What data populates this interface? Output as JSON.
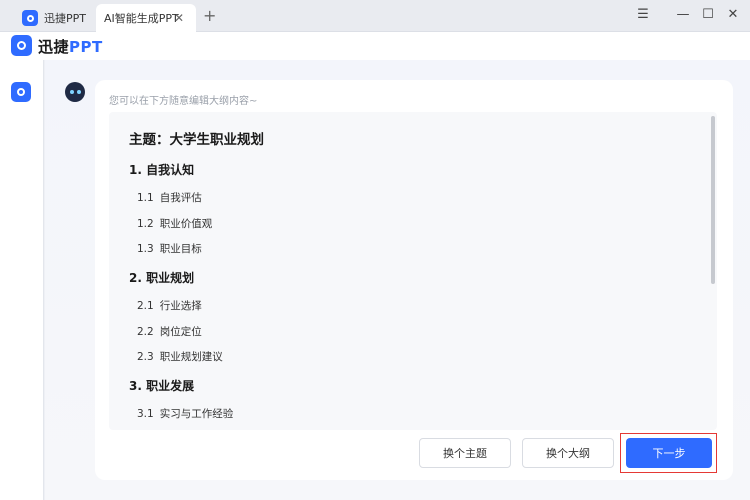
{
  "titlebar": {
    "tabs": [
      {
        "label": "迅捷PPT"
      },
      {
        "label": "AI智能生成PPT"
      }
    ],
    "close_glyph": "✕",
    "add_glyph": "+",
    "controls": {
      "menu": "☰",
      "minimize": "—",
      "maximize": "☐",
      "close": "✕"
    }
  },
  "app": {
    "brand_prefix": "迅捷",
    "brand_suffix": "PPT"
  },
  "content": {
    "hint": "您可以在下方随意编辑大纲内容~",
    "outline": {
      "title": "主题：大学生职业规划",
      "sections": [
        {
          "heading": "1. 自我认知",
          "items": [
            {
              "num": "1.1",
              "text": "自我评估"
            },
            {
              "num": "1.2",
              "text": "职业价值观"
            },
            {
              "num": "1.3",
              "text": "职业目标"
            }
          ]
        },
        {
          "heading": "2. 职业规划",
          "items": [
            {
              "num": "2.1",
              "text": "行业选择"
            },
            {
              "num": "2.2",
              "text": "岗位定位"
            },
            {
              "num": "2.3",
              "text": "职业规划建议"
            }
          ]
        },
        {
          "heading": "3. 职业发展",
          "items": [
            {
              "num": "3.1",
              "text": "实习与工作经验"
            }
          ]
        }
      ]
    },
    "buttons": {
      "change_topic": "换个主题",
      "change_outline": "换个大纲",
      "next": "下一步"
    }
  },
  "colors": {
    "accent": "#2f6bff",
    "highlight_border": "#e53935"
  }
}
